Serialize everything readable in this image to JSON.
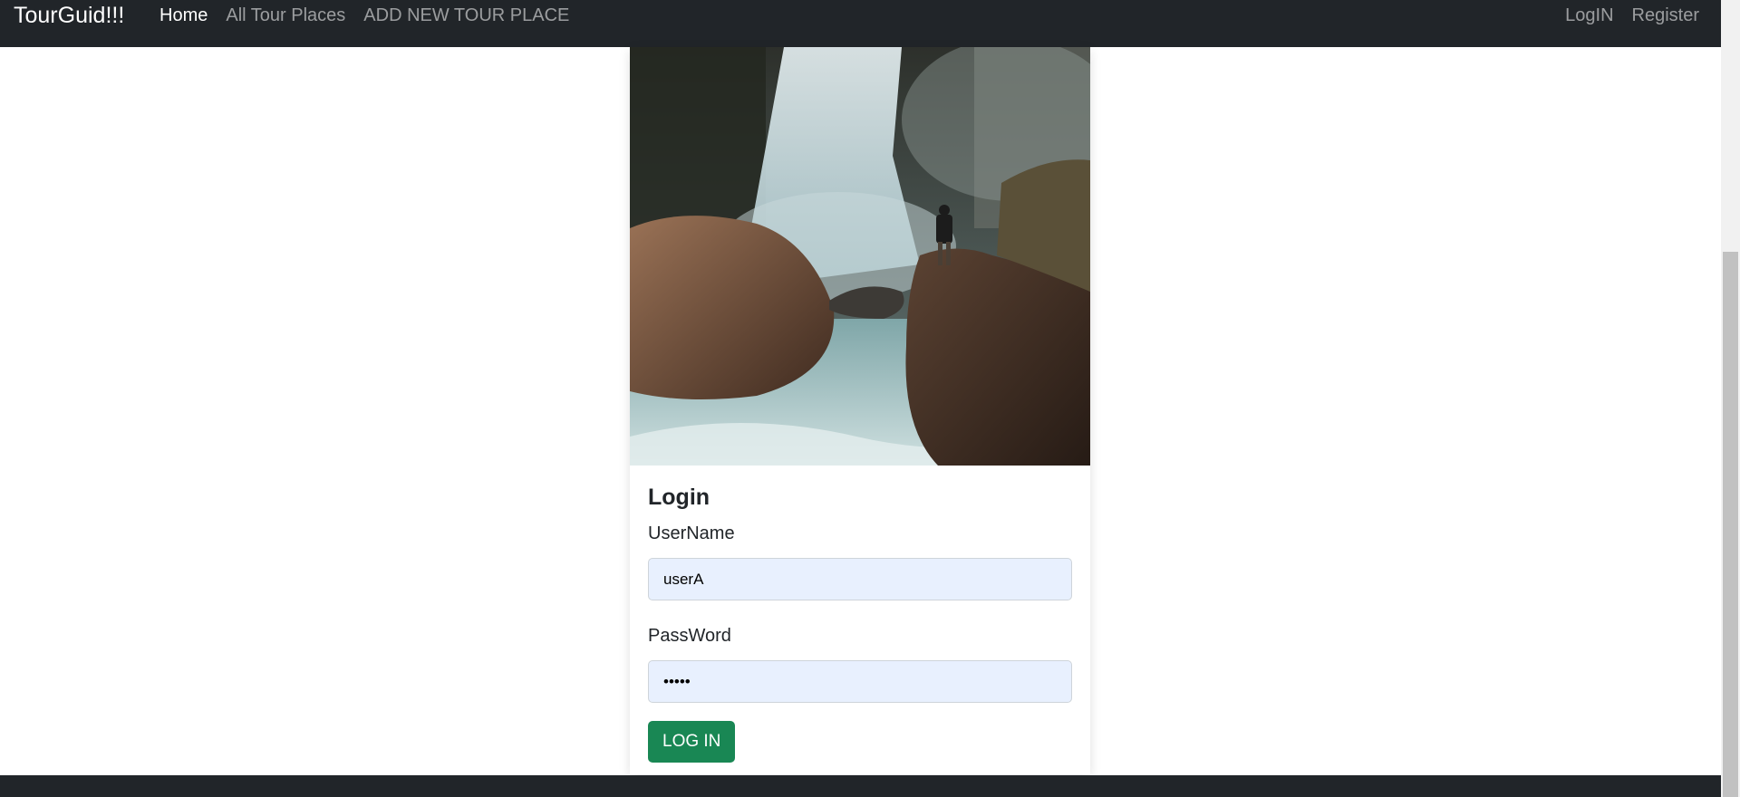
{
  "navbar": {
    "brand": "TourGuid!!!",
    "left_links": [
      "Home",
      "All Tour Places",
      "ADD NEW TOUR PLACE"
    ],
    "right_links": [
      "LogIN",
      "Register"
    ]
  },
  "login": {
    "title": "Login",
    "username_label": "UserName",
    "username_value": "userA",
    "password_label": "PassWord",
    "password_value": "•••••",
    "submit_label": "LOG IN"
  },
  "colors": {
    "navbar": "#212529",
    "button": "#198754",
    "input_bg": "#e8f0fe"
  }
}
